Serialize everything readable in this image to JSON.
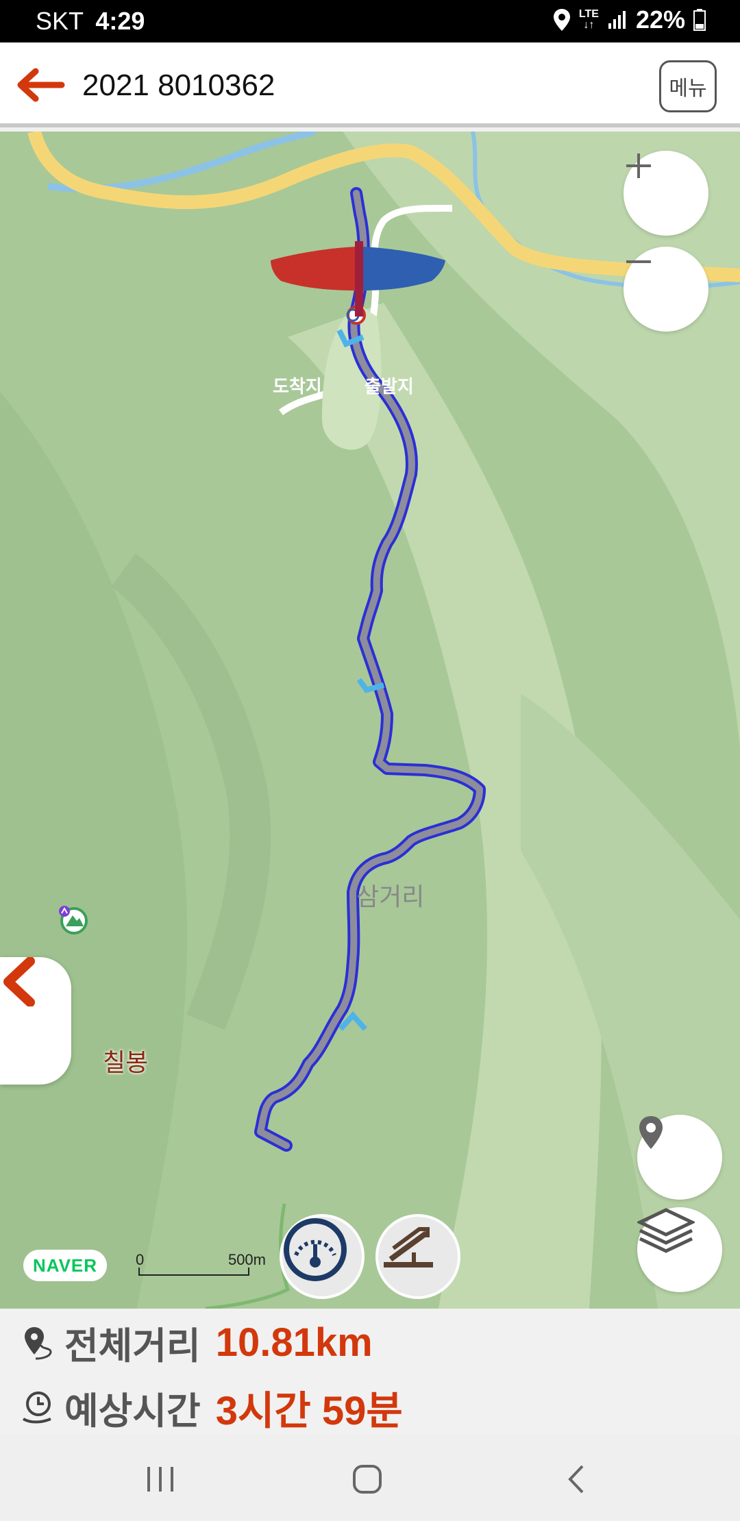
{
  "status_bar": {
    "carrier": "SKT",
    "time": "4:29",
    "network": "LTE",
    "battery": "22%"
  },
  "header": {
    "title": "2021 8010362",
    "menu_label": "메뉴"
  },
  "map": {
    "flag_destination": "도착지",
    "flag_start": "출발지",
    "place_label": "삼거리",
    "peak_label": "칠봉",
    "provider_logo": "NAVER",
    "scale_zero": "0",
    "scale_length": "500m",
    "route_color": "#2b2fd6",
    "zoom_in_label": "+",
    "zoom_out_label": "−"
  },
  "route_info": {
    "distance_label": "전체거리",
    "distance_value": "10.81km",
    "time_label": "예상시간",
    "time_value": "3시간 59분"
  },
  "icons": {
    "back": "back-arrow-icon",
    "locate": "location-pin-icon",
    "layers": "layers-icon",
    "speed": "speedometer-icon",
    "slope": "slope-icon",
    "collapse": "chevron-left-icon"
  },
  "colors": {
    "accent": "#d2380c",
    "flag_red": "#c8312a",
    "flag_blue": "#2f5fb0"
  }
}
